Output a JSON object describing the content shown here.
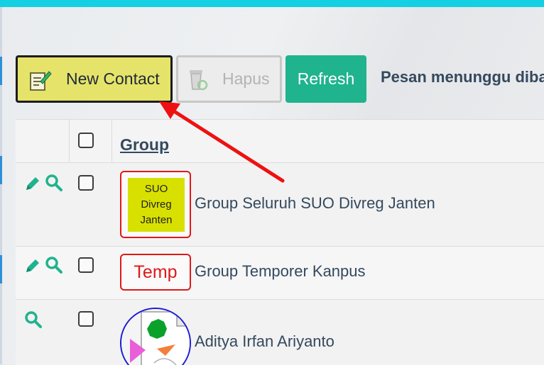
{
  "toolbar": {
    "new_contact_label": "New Contact",
    "hapus_label": "Hapus",
    "refresh_label": "Refresh"
  },
  "status_message": "Pesan menunggu diba",
  "table": {
    "header_group": "Group",
    "rows": [
      {
        "badge_lines": [
          "SUO",
          "Divreg",
          "Janten"
        ],
        "name": "Group Seluruh SUO Divreg Janten",
        "actions": [
          "edit-icon",
          "search-icon"
        ]
      },
      {
        "badge_text": "Temp",
        "name": "Group Temporer Kanpus",
        "actions": [
          "edit-icon",
          "search-icon"
        ]
      },
      {
        "avatar": "avatar-image",
        "name": "Aditya Irfan Ariyanto",
        "actions": [
          "search-icon"
        ]
      }
    ]
  },
  "colors": {
    "accent_teal": "#1fb38e",
    "top_bar": "#14d0e3",
    "new_contact_bg": "#e6e36a",
    "badge_red": "#e01818",
    "annotation_arrow": "#ee1111"
  }
}
